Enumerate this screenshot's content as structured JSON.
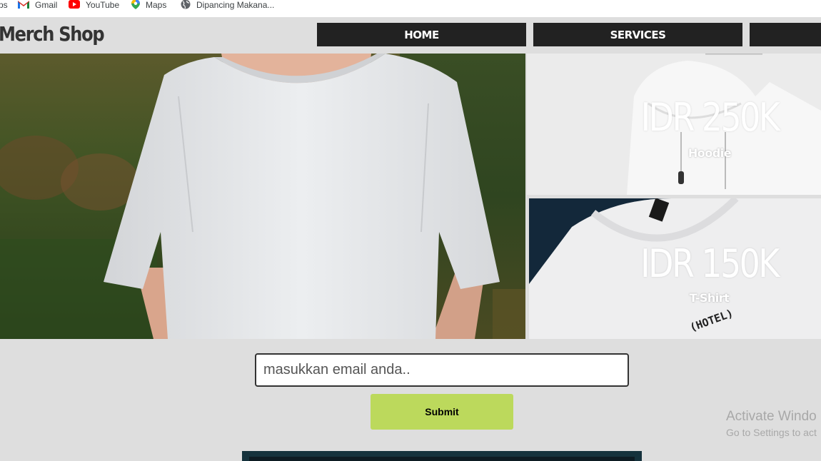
{
  "bookmarks": {
    "apps": "ps",
    "gmail": "Gmail",
    "youtube": "YouTube",
    "maps": "Maps",
    "dipancing": "Dipancing Makana..."
  },
  "header": {
    "logo": "Merch Shop",
    "nav": {
      "home": "HOME",
      "services": "SERVICES"
    }
  },
  "products": {
    "hoodie": {
      "price": "IDR 250K",
      "name": "Hoodie"
    },
    "tshirt": {
      "price": "IDR 150K",
      "name": "T-Shirt",
      "print": "(HOTEL)"
    }
  },
  "subscribe": {
    "placeholder": "masukkan email anda..",
    "submit": "Submit"
  },
  "watermark": {
    "line1": "Activate Windo",
    "line2": "Go to Settings to act"
  },
  "colors": {
    "nav_bg": "#222222",
    "submit_bg": "#bcd95c",
    "page_bg": "#dedede"
  }
}
